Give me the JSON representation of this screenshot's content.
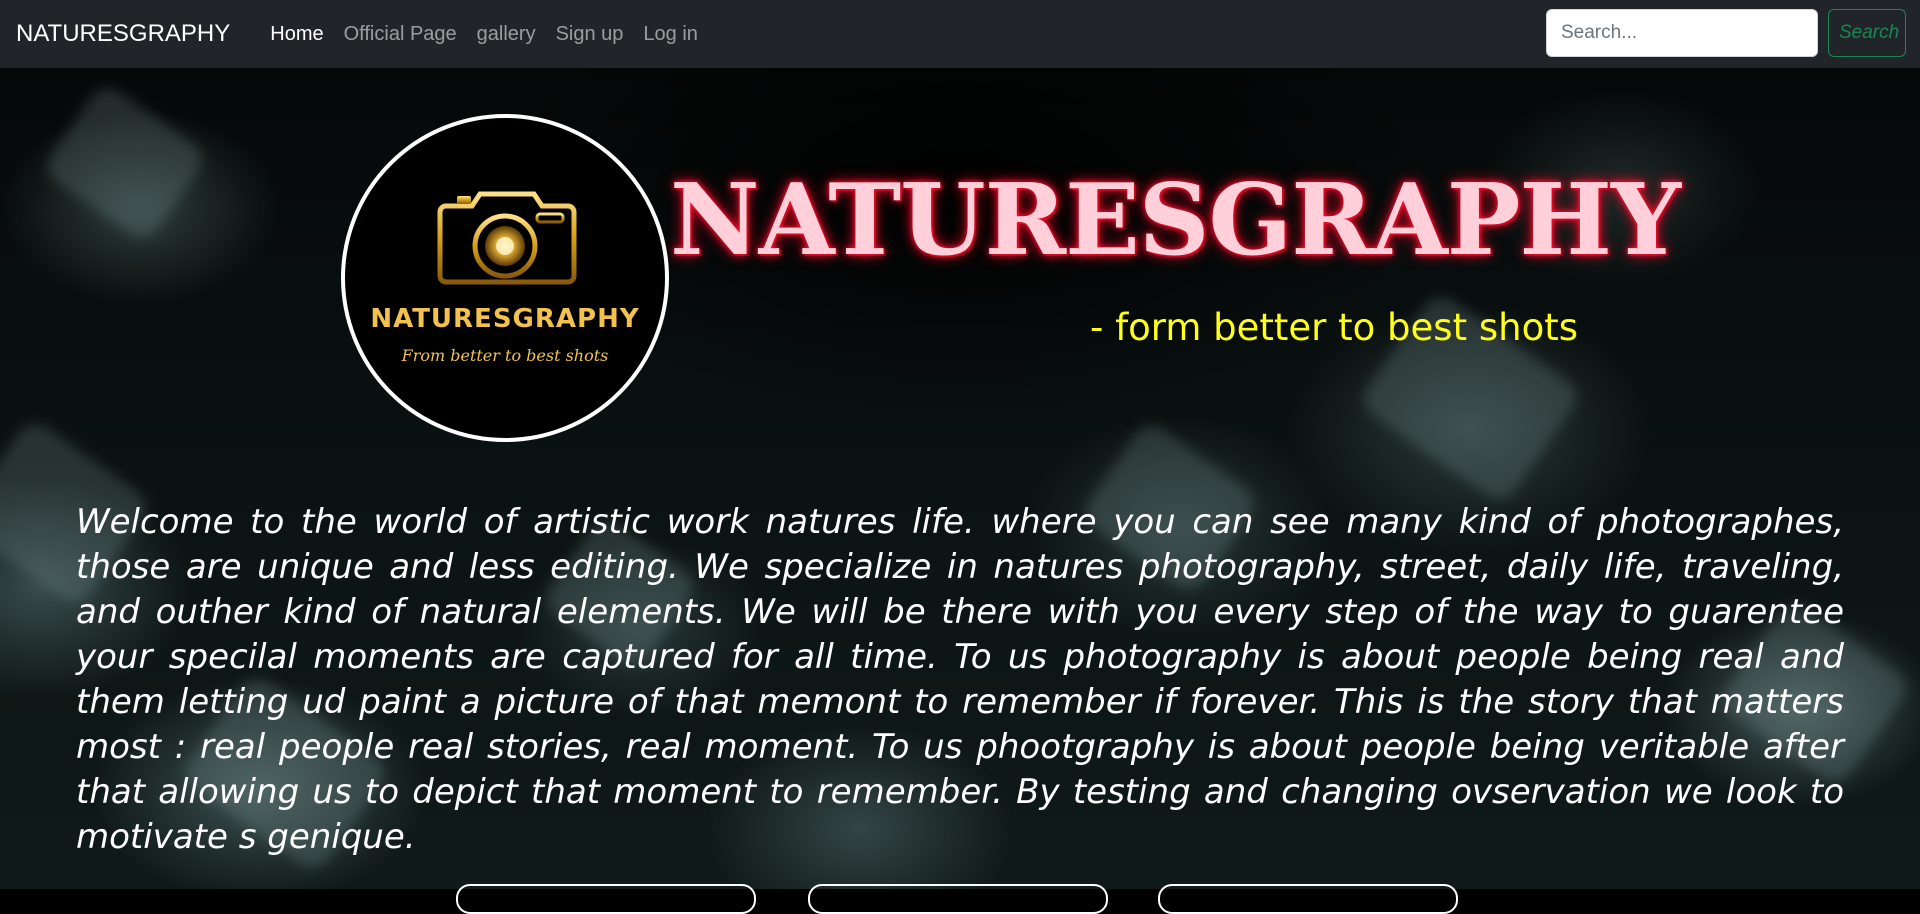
{
  "navbar": {
    "brand": "NATURESGRAPHY",
    "links": [
      "Home",
      "Official Page",
      "gallery",
      "Sign up",
      "Log in"
    ],
    "search_placeholder": "Search...",
    "search_button": "Search"
  },
  "hero": {
    "logo": {
      "name": "NATURESGRAPHY",
      "slogan": "From better to best shots",
      "icon": "camera-icon"
    },
    "title": "NATURESGRAPHY",
    "tagline": "- form better to best shots",
    "welcome_text": "Welcome to the world of artistic work natures life. where you can see many kind of photographes, those are unique and less editing. We specialize in natures photography, street, daily life, traveling, and outher kind of natural elements. We will be there with you every step of the way to guarentee your specilal moments are captured for all time. To us photography is about people being real and them letting ud paint a picture of that memont to remember if forever. This is the story that matters most : real people real stories, real moment. To us phootgraphy is about people being veritable after that allowing us to depict that moment to remember. By testing and changing ovservation we look to motivate s genique."
  },
  "colors": {
    "navbar_bg": "#212529",
    "title_glow": "#ff1a3a",
    "tagline": "#ffff1a",
    "search_button": "#198754",
    "logo_gold": "#d4a017"
  }
}
